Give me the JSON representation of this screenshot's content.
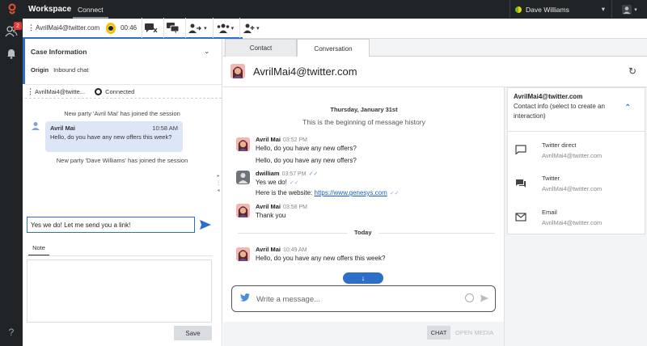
{
  "app": {
    "title": "Workspace",
    "nav_tab": "Connect"
  },
  "user": {
    "name": "Dave Williams"
  },
  "rail": {
    "notification_count": "2",
    "help": "?"
  },
  "toolbar": {
    "party": "AvrilMai4@twitter.com",
    "timer": "00:46"
  },
  "case": {
    "title": "Case Information",
    "origin_label": "Origin",
    "origin_value": "Inbound chat",
    "party": "AvrilMai4@twitte...",
    "party_status": "Connected"
  },
  "left_chat": {
    "joined_1": "New party 'Avril Mai' has joined the session",
    "bubble_name": "Avril Mai",
    "bubble_time": "10:58 AM",
    "bubble_text": "Hello, do you have any new offers this week?",
    "joined_2": "New party 'Dave Williams' has joined the session",
    "compose_value": "Yes we do! Let me send you a link!",
    "note_tab": "Note",
    "save": "Save"
  },
  "tabs": {
    "contact": "Contact",
    "conversation": "Conversation"
  },
  "conversation": {
    "header": "AvrilMai4@twitter.com",
    "day": "Thursday, January 31st",
    "beginning": "This is the beginning of message history",
    "messages": [
      {
        "name": "Avril Mai",
        "time": "03:52 PM",
        "line1": "Hello, do you have any new offers?",
        "line2": "Hello, do you have any new offers?"
      },
      {
        "name": "dwilliam",
        "time": "03:57 PM",
        "line1": "Yes we do!",
        "line2_prefix": "Here is the website:",
        "link": "https://www.genesys.com"
      },
      {
        "name": "Avril Mai",
        "time": "03:58 PM",
        "line1": "Thank you"
      },
      {
        "name": "Avril Mai",
        "time": "10:49 AM",
        "line1": "Hello, do you have any new offers this week?"
      }
    ],
    "today": "Today",
    "input_placeholder": "Write a message...",
    "chat": "CHAT",
    "open_media": "OPEN MEDIA"
  },
  "contact": {
    "title": "AvrilMai4@twitter.com",
    "subtitle": "Contact info (select to create an interaction)",
    "items": [
      {
        "type": "Twitter direct",
        "value": "AvrilMai4@twitter.com",
        "icon": "chat-bubble-icon"
      },
      {
        "type": "Twitter",
        "value": "AvrilMai4@twitter.com",
        "icon": "forum-icon"
      },
      {
        "type": "Email",
        "value": "AvrilMai4@twitter.com",
        "icon": "email-icon"
      }
    ]
  },
  "colors": {
    "topbar": "#202427",
    "accent": "#2d6ec8",
    "bubble": "#dde6f7",
    "status_ring": "#f2c200"
  }
}
